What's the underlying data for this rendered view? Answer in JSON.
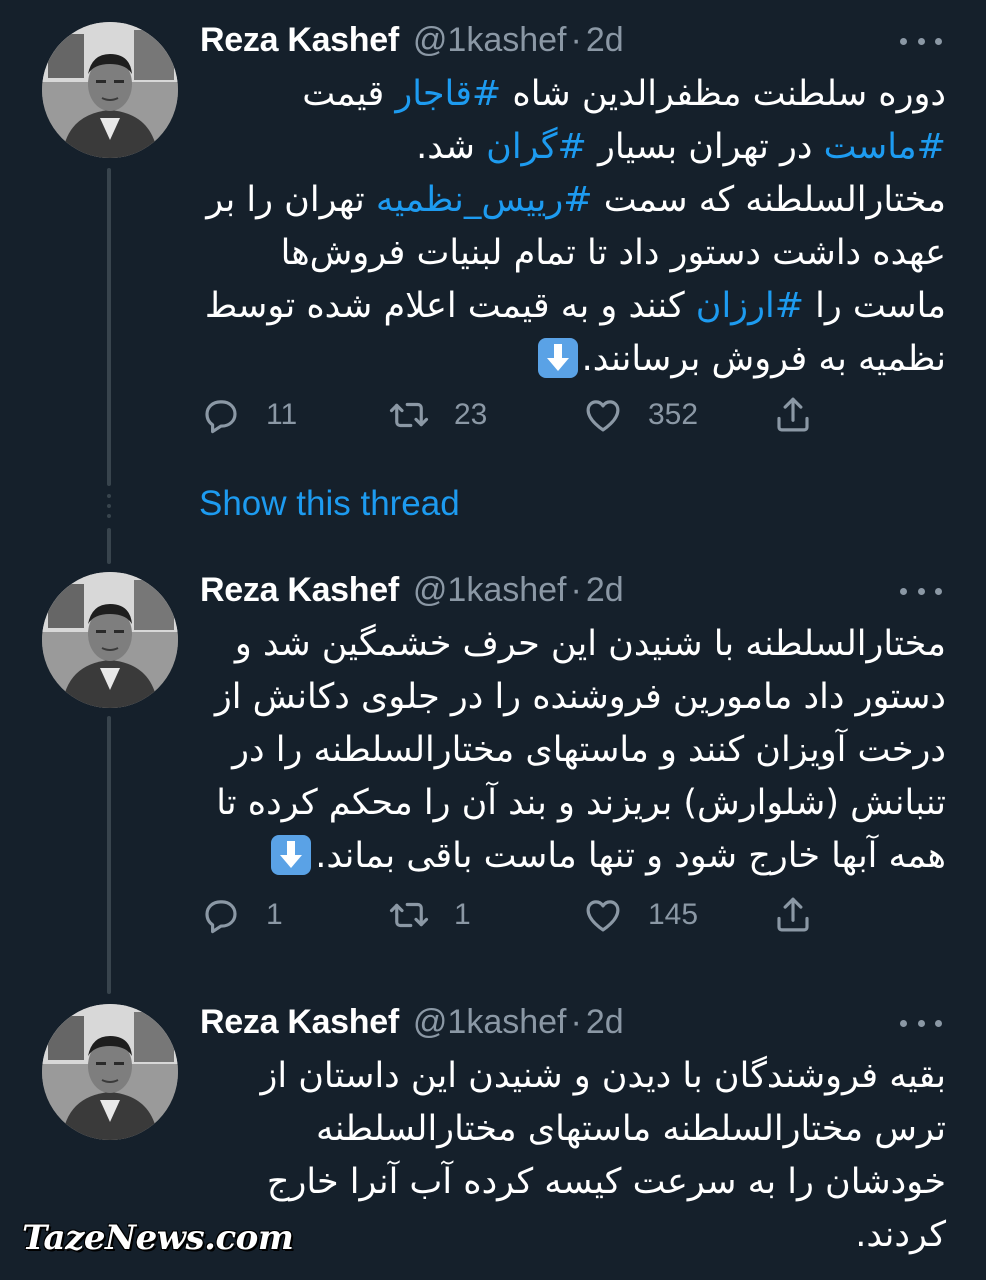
{
  "tweets": [
    {
      "author_name": "Reza Kashef",
      "handle": "@1kashef",
      "separator": "·",
      "time": "2d",
      "text": {
        "p1": "دوره سلطنت مظفرالدین شاه ",
        "tag1": "#قاجار",
        "p2": " قیمت ",
        "tag2": "#ماست",
        "p3": " در تهران بسیار ",
        "tag3": "#گران",
        "p4": " شد.",
        "p5": "مختارالسلطنه که سمت ",
        "tag4": "#رییس_نظمیه",
        "p6": " تهران را بر عهده داشت دستور داد تا تمام لبنیات فروش‌ها ماست را ",
        "tag5": "#ارزان",
        "p7": " کنند و به قیمت اعلام شده توسط نظمیه به فروش برسانند."
      },
      "emoji": "down-arrow-emoji",
      "replies": "11",
      "retweets": "23",
      "likes": "352"
    },
    {
      "author_name": "Reza Kashef",
      "handle": "@1kashef",
      "separator": "·",
      "time": "2d",
      "text": {
        "p1": "مختارالسلطنه با شنیدن این حرف خشمگین شد و دستور داد مامورین فروشنده را در جلوی دکانش از درخت آویزان کنند و ماستهای مختارالسلطنه را در تنبانش (شلوارش) بریزند و بند آن را محکم کرده تا همه آبها خارج شود و تنها ماست باقی بماند."
      },
      "emoji": "down-arrow-emoji",
      "replies": "1",
      "retweets": "1",
      "likes": "145"
    },
    {
      "author_name": "Reza Kashef",
      "handle": "@1kashef",
      "separator": "·",
      "time": "2d",
      "text": {
        "p1": "بقیه فروشندگان با دیدن و شنیدن این داستان از ترس مختارالسلطنه ماستهای مختارالسلطنه خودشان را به سرعت  کیسه کرده آب آنرا خارج کردند."
      }
    }
  ],
  "show_thread": "Show this thread",
  "watermark": "TazeNews.com",
  "icons": {
    "reply": "reply-icon",
    "retweet": "retweet-icon",
    "like": "heart-icon",
    "share": "share-icon",
    "more": "more-icon"
  },
  "colors": {
    "background": "#15202b",
    "link": "#1d9bf0",
    "muted": "#8b98a5",
    "thread_line": "#38444d"
  }
}
